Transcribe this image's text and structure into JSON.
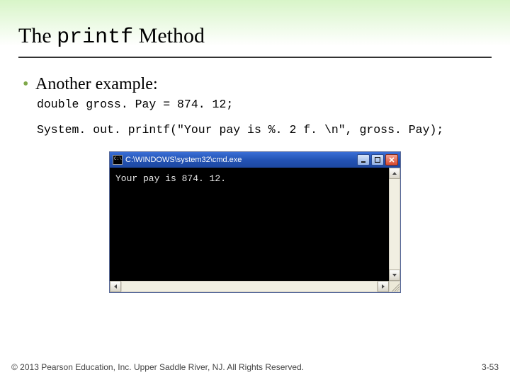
{
  "title_prefix": "The ",
  "title_mono": "printf",
  "title_suffix": " Method",
  "bullet": "Another example:",
  "code_line1": "double gross. Pay = 874. 12;",
  "code_line2": "System. out. printf(\"Your pay is %. 2 f. \\n\", gross. Pay);",
  "cmd": {
    "title": "C:\\WINDOWS\\system32\\cmd.exe",
    "output": "Your pay is 874. 12."
  },
  "footer": {
    "copyright": "© 2013 Pearson Education, Inc. Upper Saddle River, NJ. All Rights Reserved.",
    "page": "3-53"
  }
}
